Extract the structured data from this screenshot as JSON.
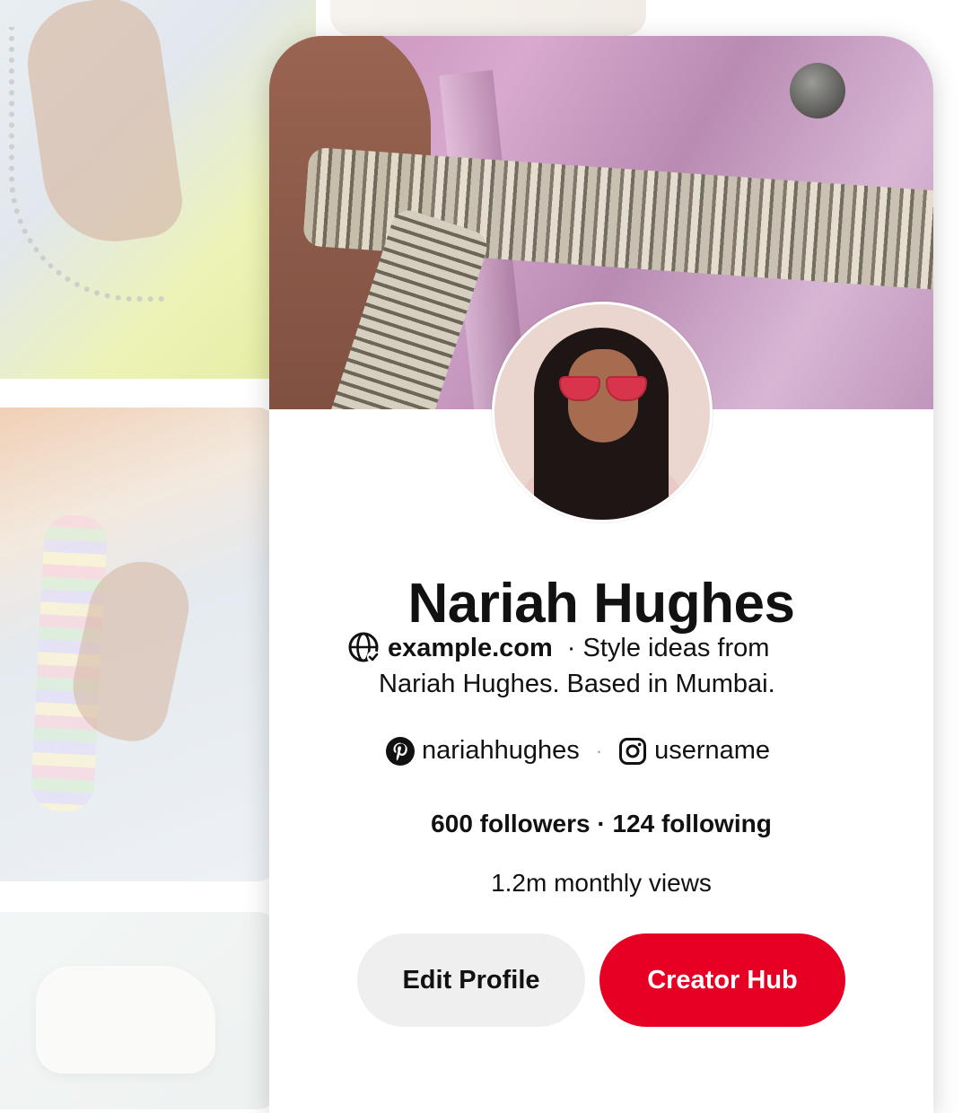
{
  "profile": {
    "name": "Nariah Hughes",
    "website": "example.com",
    "bio_line1": "· Style ideas from",
    "bio_line2": "Nariah Hughes. Based in Mumbai.",
    "pinterest_handle": "nariahhughes",
    "instagram_handle": "username",
    "stats": "600 followers · 124 following",
    "monthly_views": "1.2m monthly views"
  },
  "actions": {
    "edit_label": "Edit Profile",
    "creator_label": "Creator Hub"
  },
  "icons": {
    "website": "globe-check-icon",
    "pinterest": "pinterest-icon",
    "instagram": "instagram-icon"
  },
  "colors": {
    "accent": "#e60023",
    "secondary_button": "#efefef",
    "text": "#111111"
  }
}
